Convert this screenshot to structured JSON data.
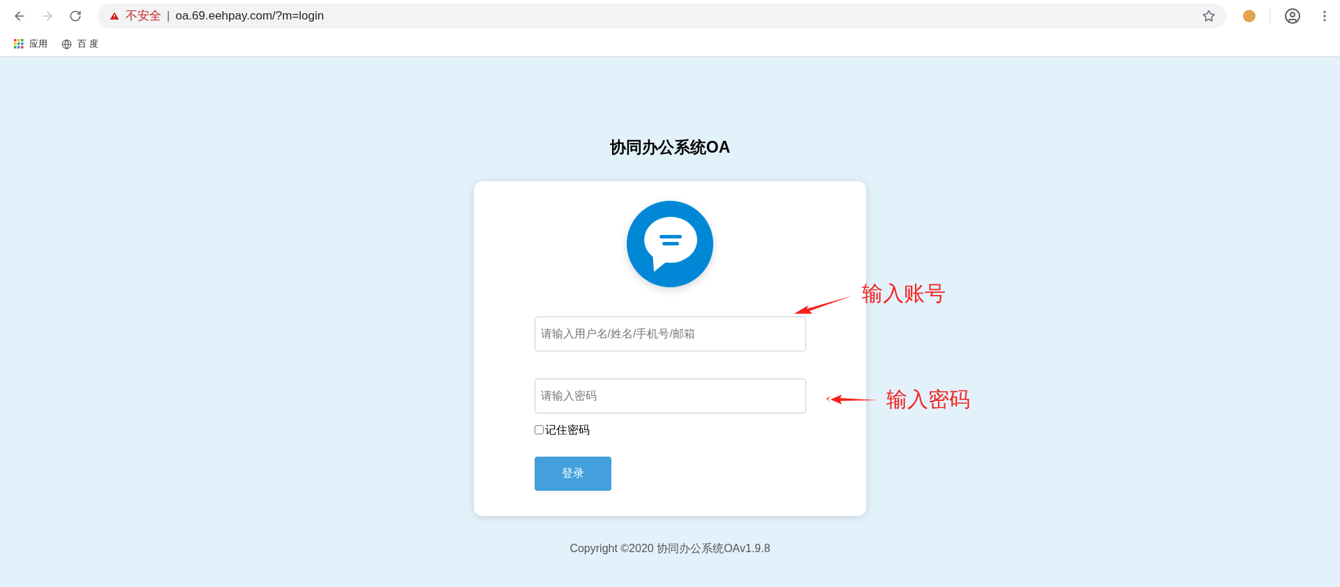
{
  "browser": {
    "security_label": "不安全",
    "separator": "|",
    "url": "oa.69.eehpay.com/?m=login"
  },
  "bookmarks": [
    {
      "kind": "apps",
      "label": "应用"
    },
    {
      "kind": "globe",
      "label": "百 度"
    }
  ],
  "login": {
    "title": "协同办公系统OA",
    "username": {
      "placeholder": "请输入用户名/姓名/手机号/邮箱"
    },
    "password": {
      "placeholder": "请输入密码"
    },
    "remember": {
      "label": "记住密码",
      "checked": false
    },
    "submit": "登录"
  },
  "footer": "Copyright ©2020 协同办公系统OAv1.9.8",
  "annotations": [
    {
      "label": "输入账号"
    },
    {
      "label": "输入密码"
    }
  ]
}
